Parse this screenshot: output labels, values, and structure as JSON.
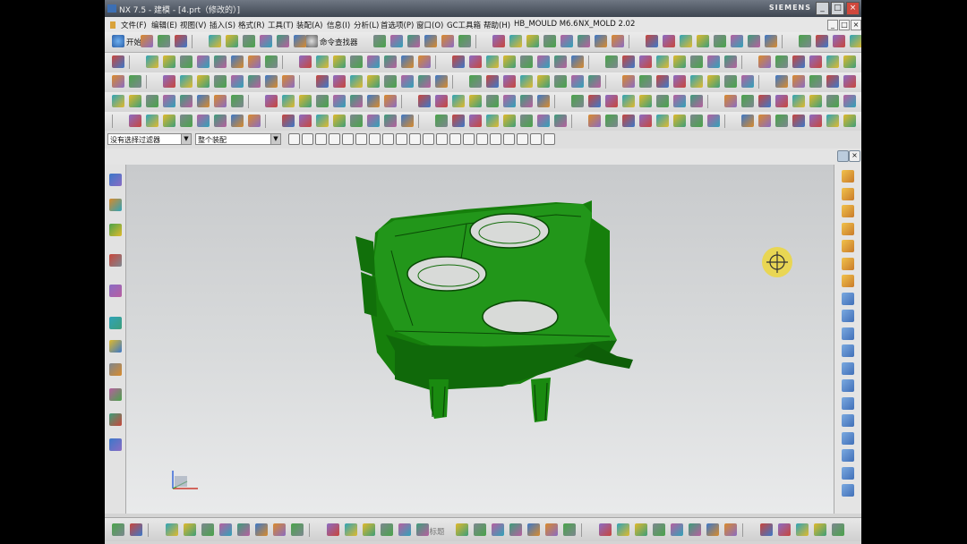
{
  "window": {
    "title": "NX 7.5 - 建模 - [4.prt（修改的）]",
    "brand": "SIEMENS",
    "controls": [
      "_",
      "□",
      "×"
    ]
  },
  "menu": {
    "items": [
      "文件(F)",
      "编辑(E)",
      "视图(V)",
      "插入(S)",
      "格式(R)",
      "工具(T)",
      "装配(A)",
      "信息(I)",
      "分析(L)",
      "首选项(P)",
      "窗口(O)",
      "GC工具箱",
      "帮助(H)",
      "HB_MOULD M6.6",
      "NX_MOLD 2.02"
    ],
    "doc_controls": [
      "_",
      "□",
      "×"
    ]
  },
  "toolbar": {
    "start_label": "开始",
    "command_finder_label": "命令查找器"
  },
  "filter": {
    "selection_filter": "没有选择过滤器",
    "assembly_scope": "整个装配"
  },
  "bottom_toolbar": {
    "overlay_label": "无标题"
  },
  "colors": {
    "part_green": "#1e8a12",
    "part_dark": "#0f5e08",
    "highlight_cursor": "#f0d728",
    "graphics_background": "#d9dbdc"
  },
  "icons": {
    "left_resource_bar": [
      "assembly-navigator-icon",
      "constraint-navigator-icon",
      "part-navigator-icon",
      "web-browser-icon",
      "history-icon",
      "system-materials-icon",
      "process-studio-icon",
      "manufacturing-wizard-icon",
      "roles-icon",
      "system-scenes-icon",
      "palette-icon"
    ],
    "right_toolbar": [
      "mold-wizard-icon",
      "part-family-icon",
      "workpiece-icon",
      "layout-icon",
      "parting-icon",
      "mold-base-icon",
      "standard-part-icon",
      "ejector-pin-icon",
      "slider-icon",
      "sub-insert-icon",
      "gate-icon",
      "runner-icon",
      "cooling-icon",
      "electrode-icon",
      "trim-icon",
      "pocket-icon",
      "bom-icon",
      "drawing-icon",
      "view-manager-icon"
    ]
  }
}
